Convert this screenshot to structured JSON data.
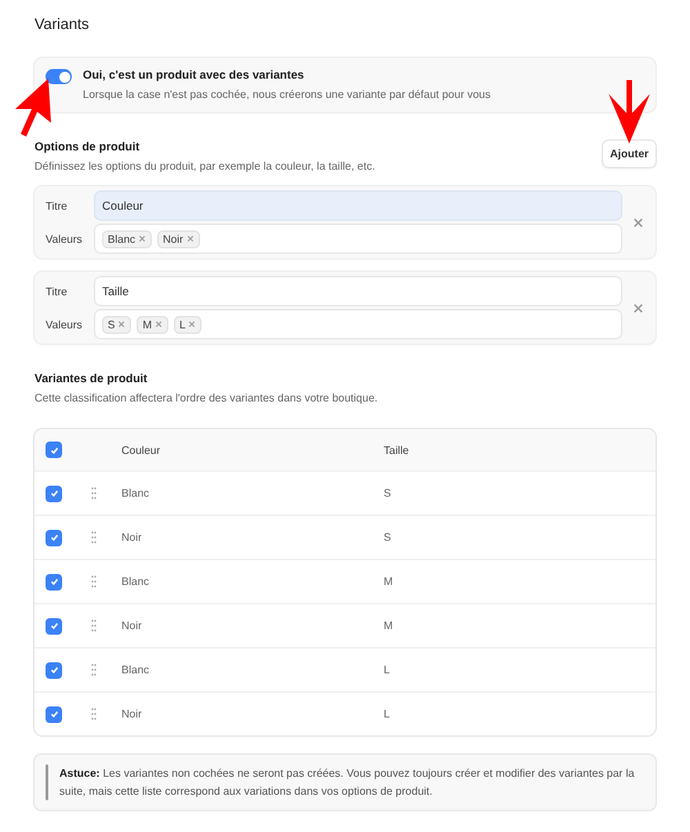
{
  "title": "Variants",
  "variant_toggle": {
    "on": true,
    "label": "Oui, c'est un produit avec des variantes",
    "description": "Lorsque la case n'est pas cochée, nous créerons une variante par défaut pour vous"
  },
  "options_section": {
    "heading": "Options de produit",
    "description": "Définissez les options du produit, par exemple la couleur, la taille, etc.",
    "add_button": "Ajouter"
  },
  "options": [
    {
      "title_label": "Titre",
      "title_value": "Couleur",
      "focused": true,
      "values_label": "Valeurs",
      "values": [
        "Blanc",
        "Noir"
      ]
    },
    {
      "title_label": "Titre",
      "title_value": "Taille",
      "focused": false,
      "values_label": "Valeurs",
      "values": [
        "S",
        "M",
        "L"
      ]
    }
  ],
  "variants_section": {
    "heading": "Variantes de produit",
    "description": "Cette classification affectera l'ordre des variantes dans votre boutique."
  },
  "table": {
    "all_checked": true,
    "columns": [
      "Couleur",
      "Taille"
    ],
    "rows": [
      {
        "checked": true,
        "cells": [
          "Blanc",
          "S"
        ]
      },
      {
        "checked": true,
        "cells": [
          "Noir",
          "S"
        ]
      },
      {
        "checked": true,
        "cells": [
          "Blanc",
          "M"
        ]
      },
      {
        "checked": true,
        "cells": [
          "Noir",
          "M"
        ]
      },
      {
        "checked": true,
        "cells": [
          "Blanc",
          "L"
        ]
      },
      {
        "checked": true,
        "cells": [
          "Noir",
          "L"
        ]
      }
    ]
  },
  "tip": "**Astuce:** Les variantes non cochées ne seront pas créées. Vous pouvez toujours créer et modifier des variantes par la suite, mais cette liste correspond aux variations dans vos options de produit."
}
